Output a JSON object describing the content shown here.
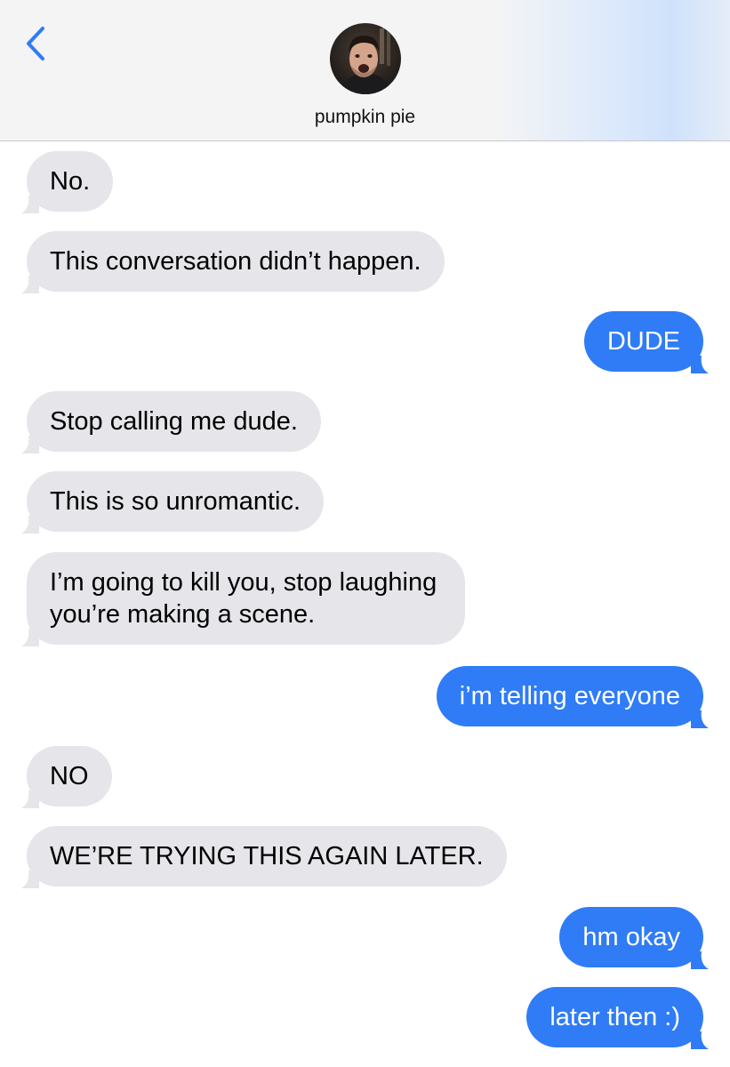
{
  "contact": {
    "name": "pumpkin pie"
  },
  "colors": {
    "received_bubble": "#e5e5ea",
    "sent_bubble": "#2f7cf6",
    "accent": "#2f7cf6"
  },
  "messages": [
    {
      "from": "them",
      "text": "No."
    },
    {
      "from": "them",
      "text": "This conversation didn’t happen."
    },
    {
      "from": "me",
      "text": "DUDE"
    },
    {
      "from": "them",
      "text": "Stop calling me dude."
    },
    {
      "from": "them",
      "text": "This is so unromantic."
    },
    {
      "from": "them",
      "lines": [
        "I’m going to kill you, stop laughing",
        "you’re making a scene."
      ]
    },
    {
      "from": "me",
      "text": "i’m telling everyone"
    },
    {
      "from": "them",
      "text": "NO"
    },
    {
      "from": "them",
      "text": "WE’RE TRYING THIS AGAIN LATER."
    },
    {
      "from": "me",
      "text": "hm okay"
    },
    {
      "from": "me",
      "text": "later then :)"
    }
  ]
}
